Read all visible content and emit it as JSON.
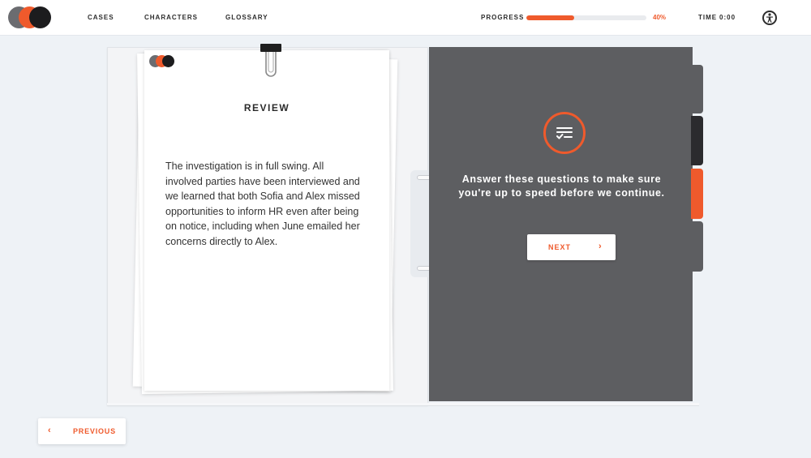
{
  "colors": {
    "accent": "#ef5a2c",
    "dark_page": "#5d5e61",
    "logo_gray": "#6b6c70",
    "logo_orange": "#ef5a2c",
    "logo_black": "#1c1c1e"
  },
  "header": {
    "nav": [
      "CASES",
      "CHARACTERS",
      "GLOSSARY"
    ],
    "progress_label": "PROGRESS",
    "progress_value": 0.4,
    "progress_text": "40%",
    "time_label": "TIME",
    "time_value": "0:00",
    "accessibility_icon": "accessibility-icon"
  },
  "review_page": {
    "title": "REVIEW",
    "body": "The investigation is in full swing. All involved parties have been interviewed and we learned that both Sofia and Alex missed opportunities to inform HR even after being on notice, including when June emailed her concerns directly to Alex."
  },
  "quiz_page": {
    "icon": "checklist-icon",
    "text": "Answer these questions to make sure you're up to speed before we continue.",
    "next_label": "NEXT"
  },
  "footer": {
    "previous_label": "PREVIOUS"
  }
}
